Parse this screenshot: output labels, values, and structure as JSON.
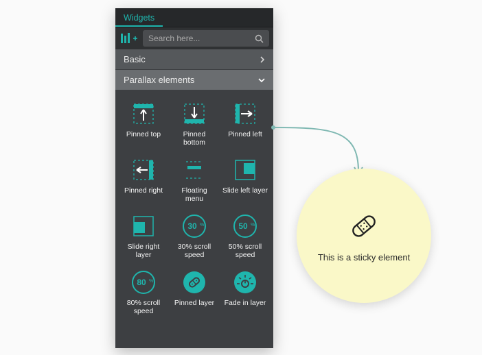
{
  "tabs": {
    "widgets": "Widgets"
  },
  "search": {
    "placeholder": "Search here..."
  },
  "categories": {
    "basic": "Basic",
    "parallax": "Parallax elements"
  },
  "items": [
    {
      "label": "Pinned top"
    },
    {
      "label": "Pinned bottom"
    },
    {
      "label": "Pinned left"
    },
    {
      "label": "Pinned right"
    },
    {
      "label": "Floating menu"
    },
    {
      "label": "Slide left layer"
    },
    {
      "label": "Slide right layer"
    },
    {
      "label": "30% scroll speed",
      "pct": "30"
    },
    {
      "label": "50% scroll speed",
      "pct": "50"
    },
    {
      "label": "80% scroll speed",
      "pct": "80"
    },
    {
      "label": "Pinned layer"
    },
    {
      "label": "Fade in layer"
    }
  ],
  "callout": {
    "text": "This is a sticky element"
  }
}
